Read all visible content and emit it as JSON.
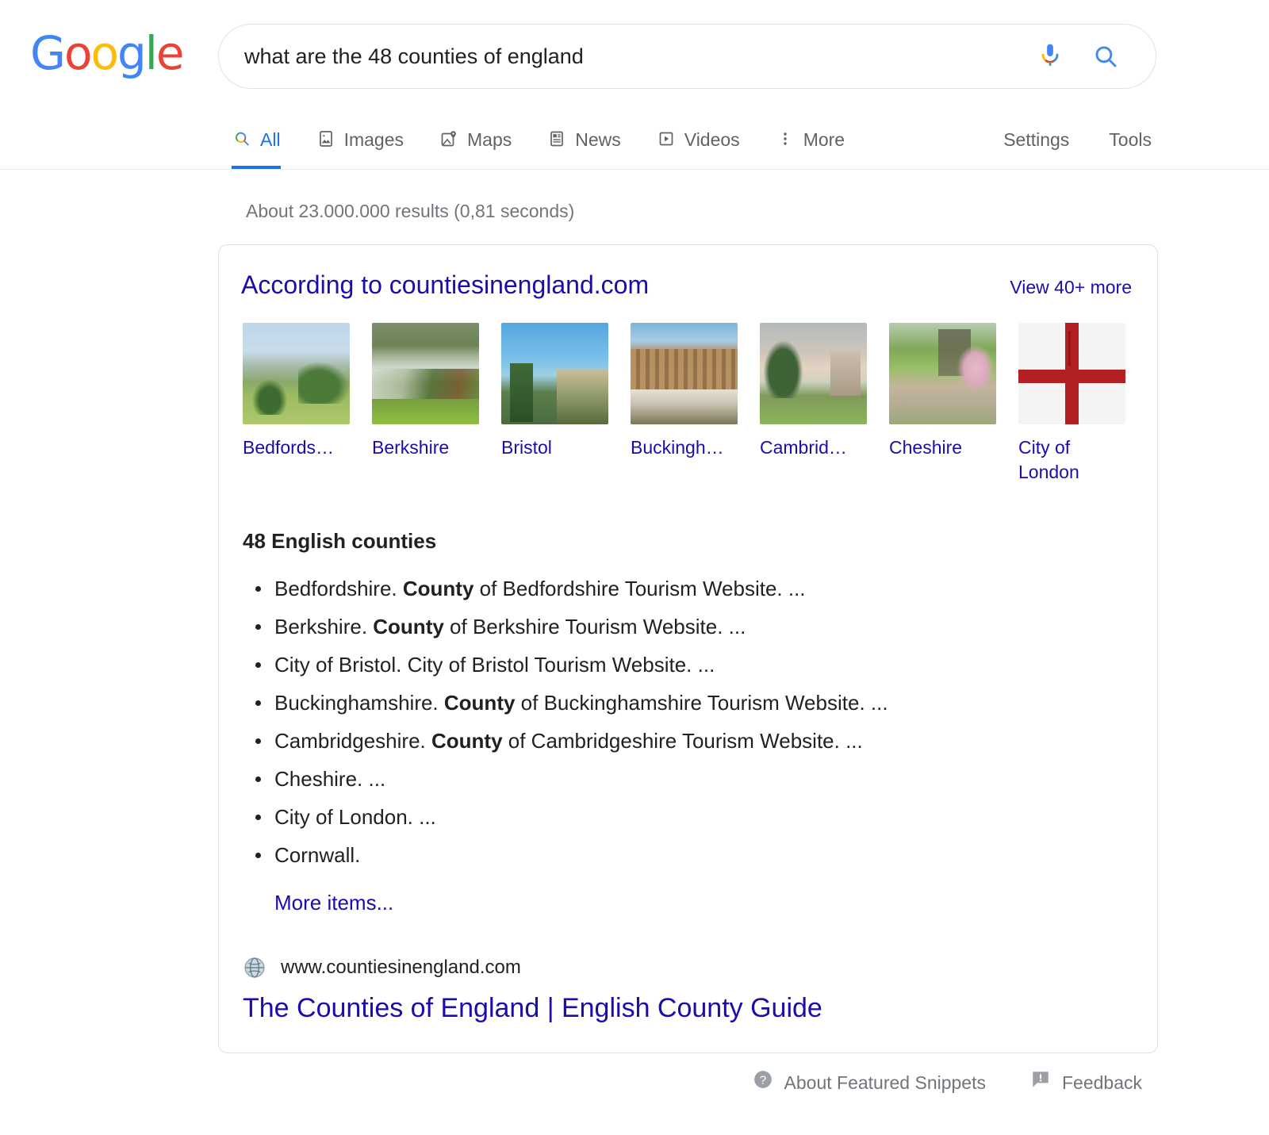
{
  "logo": {
    "letters": [
      {
        "ch": "G",
        "color": "#4285F4"
      },
      {
        "ch": "o",
        "color": "#EA4335"
      },
      {
        "ch": "o",
        "color": "#FBBC05"
      },
      {
        "ch": "g",
        "color": "#4285F4"
      },
      {
        "ch": "l",
        "color": "#34A853"
      },
      {
        "ch": "e",
        "color": "#EA4335"
      }
    ],
    "alt": "Google"
  },
  "search": {
    "query": "what are the 48 counties of england",
    "placeholder": "Search",
    "mic_icon": "microphone-icon",
    "search_icon": "search-icon"
  },
  "nav": {
    "tabs": [
      {
        "label": "All",
        "icon": "search-icon",
        "active": true
      },
      {
        "label": "Images",
        "icon": "image-icon",
        "active": false
      },
      {
        "label": "Maps",
        "icon": "map-pin-icon",
        "active": false
      },
      {
        "label": "News",
        "icon": "newspaper-icon",
        "active": false
      },
      {
        "label": "Videos",
        "icon": "play-icon",
        "active": false
      },
      {
        "label": "More",
        "icon": "more-vertical-icon",
        "active": false
      }
    ],
    "right": [
      {
        "label": "Settings"
      },
      {
        "label": "Tools"
      }
    ]
  },
  "result_stats": "About 23.000.000 results (0,81 seconds)",
  "snippet": {
    "according_to": "According to countiesinengland.com",
    "view_more": "View 40+ more",
    "thumbnails": [
      {
        "label": "Bedfords…",
        "art": "art-bed",
        "name": "thumbnail-bedfordshire"
      },
      {
        "label": "Berkshire",
        "art": "art-berk",
        "name": "thumbnail-berkshire"
      },
      {
        "label": "Bristol",
        "art": "art-bri",
        "name": "thumbnail-bristol"
      },
      {
        "label": "Buckingh…",
        "art": "art-buck",
        "name": "thumbnail-buckinghamshire"
      },
      {
        "label": "Cambrid…",
        "art": "art-camb",
        "name": "thumbnail-cambridgeshire"
      },
      {
        "label": "Cheshire",
        "art": "art-ches",
        "name": "thumbnail-cheshire"
      },
      {
        "label": "City of London",
        "art": "art-col",
        "name": "thumbnail-city-of-london"
      }
    ],
    "list_title": "48 English counties",
    "items": [
      {
        "pre": "Bedfordshire. ",
        "bold": "County",
        "post": " of Bedfordshire Tourism Website. ..."
      },
      {
        "pre": "Berkshire. ",
        "bold": "County",
        "post": " of Berkshire Tourism Website. ..."
      },
      {
        "pre": "City of Bristol. City of Bristol Tourism Website. ...",
        "bold": "",
        "post": ""
      },
      {
        "pre": "Buckinghamshire. ",
        "bold": "County",
        "post": " of Buckinghamshire Tourism Website. ..."
      },
      {
        "pre": "Cambridgeshire. ",
        "bold": "County",
        "post": " of Cambridgeshire Tourism Website. ..."
      },
      {
        "pre": "Cheshire. ...",
        "bold": "",
        "post": ""
      },
      {
        "pre": "City of London. ...",
        "bold": "",
        "post": ""
      },
      {
        "pre": "Cornwall.",
        "bold": "",
        "post": ""
      }
    ],
    "more_items": "More items...",
    "source_url": "www.countiesinengland.com",
    "source_title": "The Counties of England | English County Guide",
    "favicon": "globe-icon"
  },
  "footer": {
    "about": {
      "label": "About Featured Snippets",
      "icon": "help-circle-icon"
    },
    "feedback": {
      "label": "Feedback",
      "icon": "feedback-icon"
    }
  },
  "colors": {
    "link": "#1a0dab",
    "accent": "#1a73e8",
    "text": "#202124",
    "muted": "#70757a",
    "border": "#dfe1e5"
  }
}
